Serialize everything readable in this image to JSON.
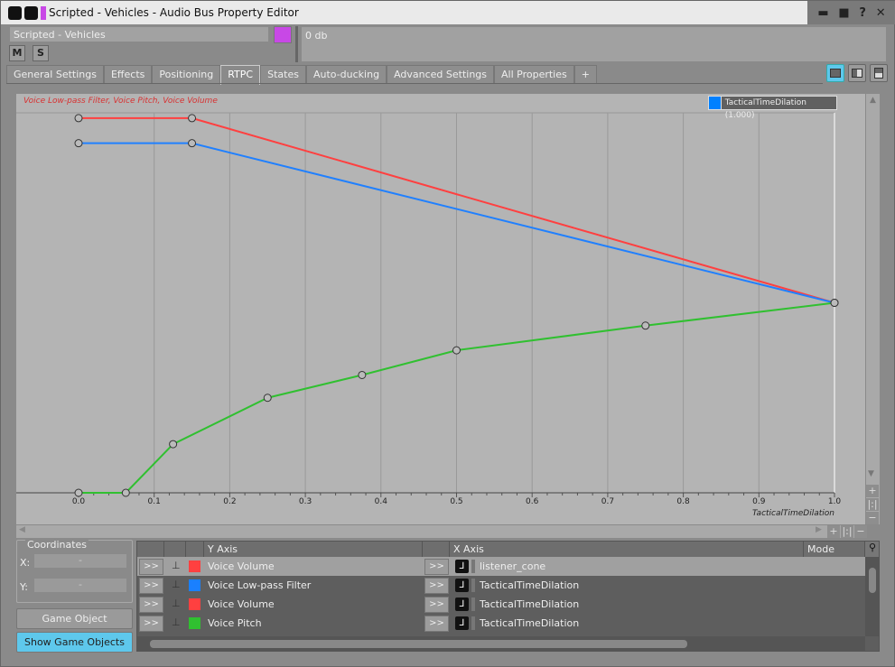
{
  "window": {
    "title": "Scripted - Vehicles - Audio Bus Property Editor",
    "buttons": [
      "folder-open-icon",
      "save-icon",
      "help-icon",
      "close-icon"
    ],
    "color": "#c848e6"
  },
  "header": {
    "name": "Scripted - Vehicles",
    "mute": "M",
    "solo": "S",
    "notes": "0 db"
  },
  "tabs": [
    {
      "label": "General Settings"
    },
    {
      "label": "Effects"
    },
    {
      "label": "Positioning"
    },
    {
      "label": "RTPC",
      "active": true
    },
    {
      "label": "States"
    },
    {
      "label": "Auto-ducking"
    },
    {
      "label": "Advanced Settings"
    },
    {
      "label": "All Properties"
    },
    {
      "label": "+"
    }
  ],
  "chart_data": {
    "type": "line",
    "title": "Voice Low-pass Filter, Voice Pitch, Voice Volume",
    "xlabel": "TacticalTimeDilation",
    "xlim": [
      0,
      1
    ],
    "ylim": [
      0,
      1
    ],
    "xticks": [
      "0.0",
      "0.1",
      "0.2",
      "0.3",
      "0.4",
      "0.5",
      "0.6",
      "0.7",
      "0.8",
      "0.9",
      "1.0"
    ],
    "grid": true,
    "legend": {
      "label": "TacticalTimeDilation (1.000)",
      "color": "#0080ff",
      "position": "top-right"
    },
    "series": [
      {
        "name": "Voice Volume",
        "color": "#ff4040",
        "points": [
          [
            0,
            0.986
          ],
          [
            0.15,
            0.986
          ],
          [
            1,
            0.5
          ]
        ]
      },
      {
        "name": "Voice Low-pass Filter",
        "color": "#2080ff",
        "points": [
          [
            0,
            0.92
          ],
          [
            0.15,
            0.92
          ],
          [
            1,
            0.5
          ]
        ]
      },
      {
        "name": "Voice Pitch",
        "color": "#30c030",
        "points": [
          [
            0,
            0
          ],
          [
            0.0625,
            0
          ],
          [
            0.125,
            0.128
          ],
          [
            0.25,
            0.25
          ],
          [
            0.375,
            0.31
          ],
          [
            0.5,
            0.375
          ],
          [
            0.75,
            0.44
          ],
          [
            1,
            0.5
          ]
        ]
      }
    ]
  },
  "coordinates": {
    "label": "Coordinates",
    "x_label": "X:",
    "y_label": "Y:",
    "x_value": "-",
    "y_value": "-"
  },
  "buttons": {
    "explorer": "Game Object Explorer...",
    "show": "Show Game Objects"
  },
  "table": {
    "headers": {
      "y_axis": "Y Axis",
      "x_axis": "X Axis",
      "mode": "Mode"
    },
    "expand": ">>",
    "rows": [
      {
        "y": "Voice Volume",
        "color": "#ff4040",
        "x": "listener_cone"
      },
      {
        "y": "Voice Low-pass Filter",
        "color": "#1a80ff",
        "x": "TacticalTimeDilation"
      },
      {
        "y": "Voice Volume",
        "color": "#ff4040",
        "x": "TacticalTimeDilation"
      },
      {
        "y": "Voice Pitch",
        "color": "#30c030",
        "x": "TacticalTimeDilation"
      }
    ]
  }
}
